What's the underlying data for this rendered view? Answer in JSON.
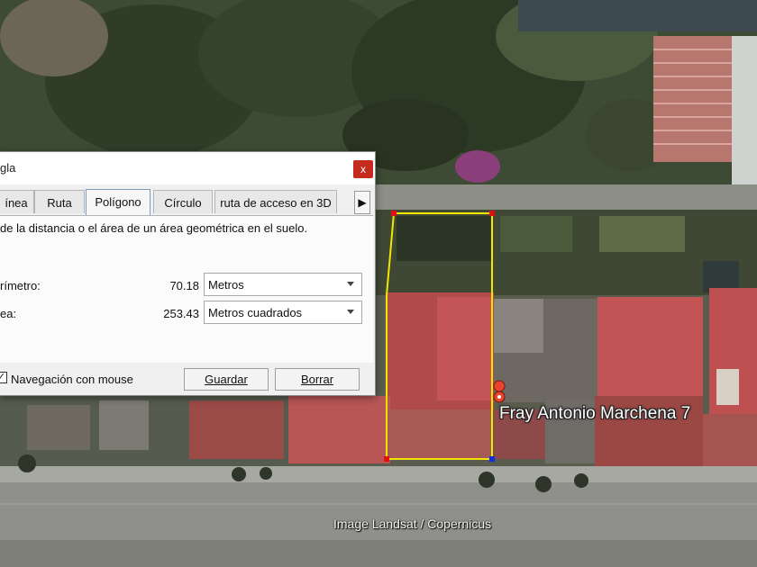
{
  "dialog": {
    "title": "gla",
    "close_glyph": "x",
    "tabs": [
      {
        "label": "ínea"
      },
      {
        "label": "Ruta"
      },
      {
        "label": "Polígono",
        "active": true
      },
      {
        "label": "Círculo"
      },
      {
        "label": "ruta de acceso en 3D"
      }
    ],
    "tab_scroll_glyph": "▶",
    "description": "de la distancia o el área de un área geométrica en el suelo.",
    "perimeter": {
      "label": "rímetro:",
      "value": "70.18",
      "unit": "Metros"
    },
    "area": {
      "label": "ea:",
      "value": "253.43",
      "unit": "Metros cuadrados"
    },
    "mouse_nav": {
      "label": "Navegación con mouse",
      "checked": true,
      "check_glyph": "✓"
    },
    "save_button": {
      "label": "Guardar"
    },
    "clear_button": {
      "label": "Borrar"
    }
  },
  "map": {
    "place_label": "Fray Antonio Marchena 7",
    "imagery_credit": "Image Landsat / Copernicus",
    "polygon_color": "#f2e600",
    "vertex_color": "#e01010",
    "active_vertex_color": "#1030e0",
    "pin_color": "#e8432e"
  }
}
